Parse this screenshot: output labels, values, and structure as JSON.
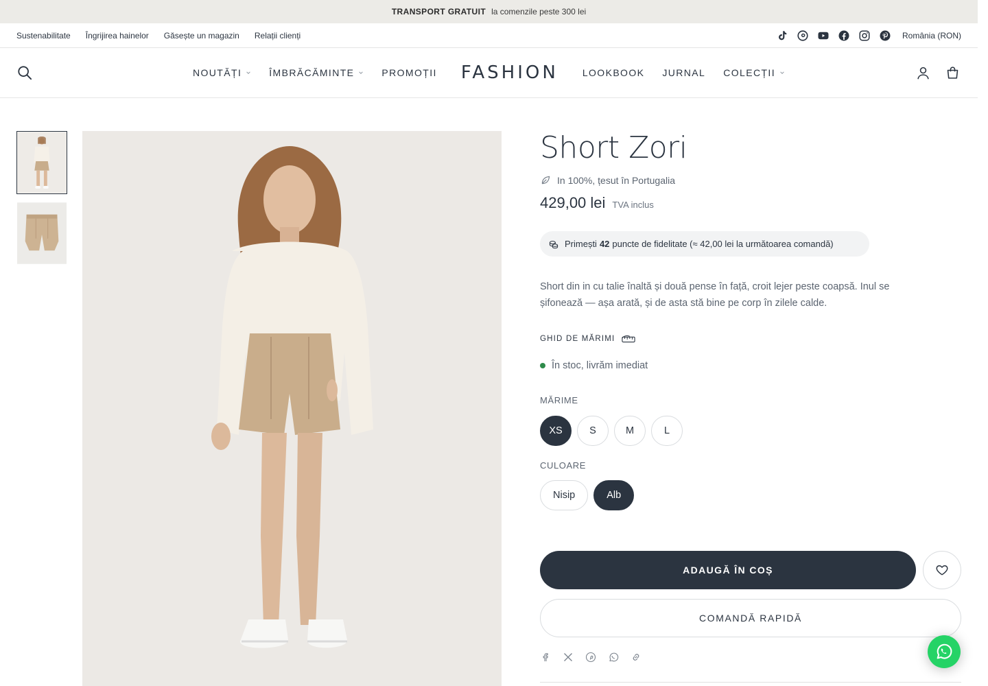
{
  "announcement": {
    "bold": "TRANSPORT GRATUIT",
    "text": "la comenzile peste 300 lei"
  },
  "utility": {
    "links": [
      "Sustenabilitate",
      "Îngrijirea hainelor",
      "Găsește un magazin",
      "Relații clienți"
    ],
    "socials": [
      "tiktok-icon",
      "threads-icon",
      "youtube-icon",
      "facebook-icon",
      "instagram-icon",
      "pinterest-icon"
    ],
    "country": "România (RON)"
  },
  "nav": {
    "items_left": [
      {
        "label": "NOUTĂȚI",
        "dropdown": true
      },
      {
        "label": "ÎMBRĂCĂMINTE",
        "dropdown": true
      },
      {
        "label": "PROMOȚII",
        "dropdown": false
      }
    ],
    "logo": "FASHION",
    "items_right": [
      {
        "label": "LOOKBOOK",
        "dropdown": false
      },
      {
        "label": "JURNAL",
        "dropdown": false
      },
      {
        "label": "COLECȚII",
        "dropdown": true
      }
    ]
  },
  "product": {
    "title": "Short Zori",
    "fabric": "In 100%, țesut în Portugalia",
    "price": "429,00 lei",
    "vat": "TVA inclus",
    "loyalty": {
      "pre": "Primești",
      "points": "42",
      "post": "puncte de fidelitate (≈ 42,00 lei la următoarea comandă)"
    },
    "description": "Short din in cu talie înaltă și două pense în față, croit lejer peste coapsă. Inul se șifonează — așa arată, și de asta stă bine pe corp în zilele calde.",
    "size_guide": "GHID DE MĂRIMI",
    "stock": "În stoc, livrăm imediat",
    "size_label": "MĂRIME",
    "sizes": [
      "XS",
      "S",
      "M",
      "L"
    ],
    "selected_size": "XS",
    "color_label": "CULOARE",
    "colors": [
      "Nisip",
      "Alb"
    ],
    "selected_color": "Alb",
    "add_to_cart": "ADAUGĂ ÎN COȘ",
    "quick_order": "COMANDĂ RAPIDĂ",
    "share": [
      "facebook-icon",
      "x-icon",
      "pinterest-icon",
      "whatsapp-icon",
      "link-icon"
    ]
  },
  "colors": {
    "primary": "#2b3440",
    "announce_bg": "#ecebe7",
    "stock_green": "#2e8b4a",
    "whatsapp": "#25d366"
  }
}
